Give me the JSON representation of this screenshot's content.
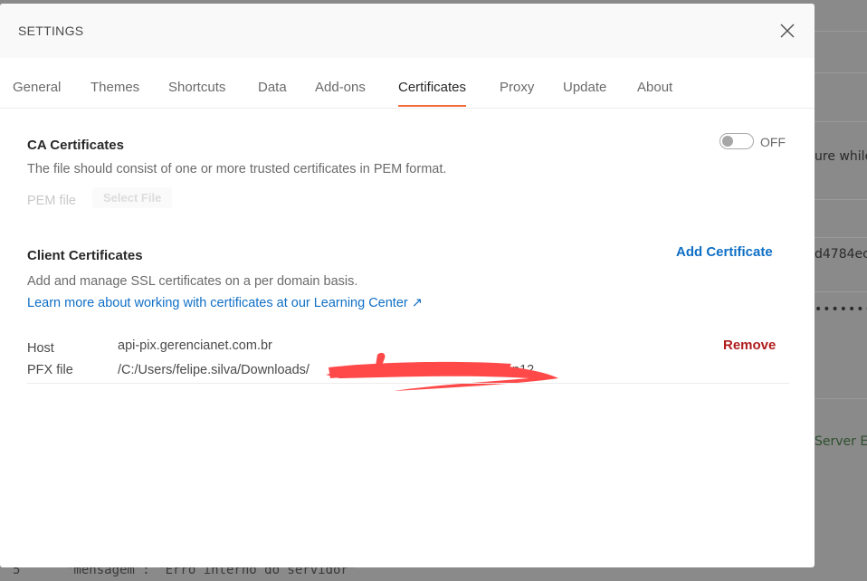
{
  "background": {
    "texts": [
      "ure while",
      "d4784ec",
      "••••••••",
      "Server Err",
      "5      \"mensagem\": \"Erro interno do servidor\""
    ]
  },
  "modal": {
    "title": "SETTINGS",
    "close_icon": "close-icon",
    "tabs": [
      "General",
      "Themes",
      "Shortcuts",
      "Data",
      "Add-ons",
      "Certificates",
      "Proxy",
      "Update",
      "About"
    ],
    "active_tab": "Certificates",
    "accent_color": "#f26b3a",
    "ca": {
      "title": "CA Certificates",
      "toggle_state": "OFF",
      "description": "The file should consist of one or more trusted certificates in PEM format.",
      "pem_label": "PEM file",
      "select_file_label": "Select File"
    },
    "client": {
      "title": "Client Certificates",
      "add_label": "Add Certificate",
      "description": "Add and manage SSL certificates on a per domain basis.",
      "learn_more": "Learn more about working with certificates at our Learning Center ↗",
      "certificates": [
        {
          "host_label": "Host",
          "host": "api-pix.gerencianet.com.br",
          "pfx_label": "PFX file",
          "pfx": "/C:/Users/felipe.silva/Downloads/",
          "pfx_tail": "p12",
          "remove_label": "Remove"
        }
      ]
    }
  }
}
